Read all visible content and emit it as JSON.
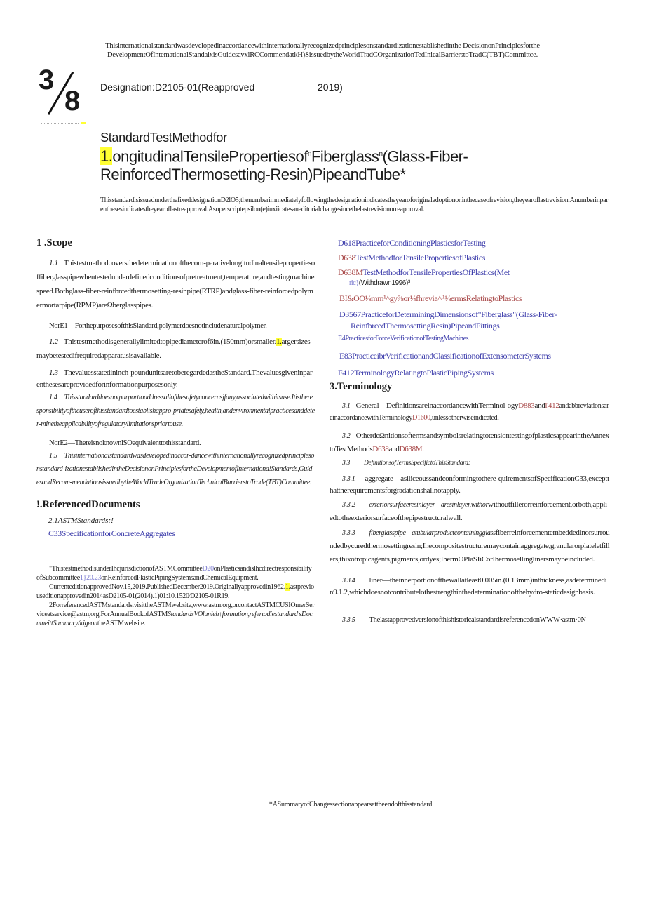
{
  "top_notice": {
    "line1": "Thisinternationalstandardwasdevelopedinaccordancewithinternationallyrecognizedprinciplesonstandardizationestablishedinthe DecisiononPrinciplesforthe",
    "line2": "DevelopmentOfIntemationalStandaixisGuidcsavxlRCCommendatkH)SissuedbytheWorldTradCOrganizationTedInicalBarrierstoTradC(TBT)Committce."
  },
  "logo": {
    "numerator": "3",
    "denominator": "8",
    "icon": "astm-logo-icon"
  },
  "designation": {
    "label": "Designation:D2105-01(Reapproved",
    "year": "2019)"
  },
  "title": {
    "line1": "StandardTestMethodfor",
    "line2_highlight": "1.",
    "line2_a": "ongitudinalTensilePropertiesof",
    "line2_sup1": "n",
    "line2_b": "Fiberglass",
    "line2_sup2": "n",
    "line2_c": "(Glass-Fiber-",
    "line3": "ReinforcedThermosetting-Resin)PipeandTube*"
  },
  "fixed_note": "ThisstandardisissuedunderthefixeddesignationD2lO5;thenumberimmediatelyfollowingthedesignationindicatestheyearoforiginaladoptionor.inthecaseofrevision,theyearoflastrevision.Anumberinparenthesesindicatestheyearoflastreapproval.Asuperscriptepsilon(e)iuxiicatesaneditorialchangesincethelastrevisionorreapproval.",
  "scope": {
    "heading": "1  .Scope",
    "p1_num": "1.1",
    "p1_text": "Thistestmethodcoversthedeterminationofthecom-parativelongitudinaltensilepropertiesoffiberglasspipewhentestedunderdefinedconditionsofpretreatment,temperature,andtestingmachinespeed.Bothglass-fiber-reinfbrcedthermosetting-resinpipe(RTRP)andglass-fiber-reinforcedpolymermortarpipe(RPMP)areΩberglasspipes.",
    "note1": "NorE1—ForthepurposesofthisSlandard,polymerdoesnotincludenaturalpolymer.",
    "p2_num": "1.2",
    "p2_text_a": "Thistestmethodisgenerallylimitedtopipediameterof6in.(150mm)orsmaller.",
    "p2_highlight": "1.",
    "p2_text_b": "argersizesmaybetestedifrequiredapparatusisavailable.",
    "p3_num": "1.3",
    "p3_text": "Thevaluesstatedininch-poundunitsaretoberegardedastheStandard.Thevaluesgiveninparenthesesareprovidedforinformationpurposesonly.",
    "p4_num": "1.4",
    "p4_text": "Thisstandarddoesnotpurporttoaddressallofthesafetyconcernsjfany,associatedwithitsuse.Itistheresponsibilityoftheuserofthisstandardtoestablishappro-priatesafety,health,andenvironmentalpracticesanddeter-minetheapplicabilityofregulatorylimitationspriortouse.",
    "note2": "NorE2—ThereisnoknownlSOequivalenttothisstandard.",
    "p5_num": "1.5",
    "p5_text": "Thisinternationalstandardwasdevelopedinaccor-dancewithinternationallyrecognizedprinciplesonstandard-izationestablishedintheDecisiononPrinciplesfortheDevelopmentofInternationa!Standards,GuidesandRecom-mendationsissuedbytheWorldTradeOrganizationTechnicalBarrierstoTrade(TBT)Committee."
  },
  "referenced": {
    "heading": "!.ReferencedDocuments",
    "sub": "2.1ASTMStandards:!",
    "c33": "C33SpecificationforConcreteAggregates"
  },
  "footnotes": {
    "f1_a": "\"ThistestmethodisunderIhcjurisdictionofASTMCommittee",
    "f1_link1": "D20",
    "f1_b": "onPlasticsandislhcdirectresponsibilityofSubcommittee",
    "f1_link2": "1}20.23",
    "f1_c": "onReinforcedPkisticPipingSystemsandChemicalEquipment.",
    "f2_a": "CurrenteditionapprovedNov.15,2019.PublishedDecember2019.Originallyapprovedin1962.",
    "f2_highlight": "1.",
    "f2_b": "astpreviouseditionapprovedin2014asD2105-01(2014).1)01:10.1520⁄D2105-01R19.",
    "f3_a": "2ForreferencedASTMstandards.visittheASTMwebsite,www.astm.org,orcontactASTMCUSIOmerServiceatservice@astm,org.ForAnnualBookofASTM",
    "f3_it": "StandardsVOlunleh↑formation,referιodiestandard'sDocutneittSummary/κigeon",
    "f3_b": "theASTMwebsite."
  },
  "right_refs": [
    {
      "code": "D618",
      "code_color": "blue",
      "text": "PracticeforConditioningPlasticsforTesting"
    },
    {
      "code": "D638",
      "code_color": "red",
      "text": "TestMethodforTensilePropertiesofPlastics"
    },
    {
      "code": "D638M",
      "code_color": "red",
      "text": "TestMethodforTensilePropertiesOfPlastics(Met",
      "cont_link": "ric}",
      "cont_plain": "(Withdrawn1996)³"
    },
    {
      "code": "BI&OO",
      "code_color": "red",
      "text": "⅛mm¹^gy⅞or¼fhrevia^ˡ¹⅛ermsRelatingtoPlastics"
    },
    {
      "code": "D3567",
      "code_color": "blue",
      "text": "PracticeforDeterminingDimensionsof\"Fiberglass\"(Glass-Fiber-",
      "cont_link": "ReinfbrcedThermosettingResin)PipeandFittings"
    },
    {
      "code": "E4",
      "code_color": "blue",
      "text": "PracticesforForceVerificationofTestingMachines"
    },
    {
      "code": "E83",
      "code_color": "blue",
      "text": "PracticeibrVerificationandClassificationofExtensometerSystems"
    },
    {
      "code": "F412",
      "code_color": "blue",
      "text": "TerminologyRelatingtoPlasticPipingSystems"
    }
  ],
  "terminology": {
    "heading": "3.Terminology",
    "p31_num": "3.1",
    "p31_a": "General—DefinitionsareinaccordancewithTerminol-ogy",
    "p31_l1": "D883",
    "p31_b": "and",
    "p31_l2": "l'412",
    "p31_c": "andabbreviationsareinaccordancewithTerminology",
    "p31_l3": "D1600",
    "p31_d": ",unlessotherwiseindicated.",
    "p32_num": "3.2",
    "p32_a": "OtherdeΩnitionsoftermsandsymbolsrelatingtotensiontestingofplasticsappearintheAnnextoTestMethods",
    "p32_l1": "D638",
    "p32_b": "and",
    "p32_l2": "D638M.",
    "p33_num": "3.3",
    "p33_text": "DefinitionsofTermsSpecifictoThisStandard:",
    "p331_num": "3.3.1",
    "p331_text": "aggregate—asiliceoussandconformingtothere-quirementsofSpecificationC33,exceptthattherequirementsforgradationshallnotapply.",
    "p332_num": "3.3.2",
    "p332_it": "exteriorsurfaceresinlayer—aresinlayer,withor",
    "p332_text": "withoutfillerorreinforcement,orboth,appliedtotheexteriorsurfaceofthepipestructuralwall.",
    "p333_num": "3.3.3",
    "p333_it": "fiberglasspipe—atubularproductcontainingglass",
    "p333_text": "fiberreinforcementembeddedinorsurroundedbycuredthermosettingresin;Ihecompositestructuremaycontainaggregate,granularorplateletfillers,thixotropicagents,pigments,ordyes;IhermOPIaSIiCorIhermosellinglinersmaybeincluded.",
    "p334_num": "3.3.4",
    "p334_text": "liner—theinnerportionofthewallatleast0.005in.(0.13mm)inthickness,asdeterminedin9.1.2,whichdoesnotcontributelothestrengthinthedeterminationofthehydro-staticdesignbasis.",
    "p335_num": "3.3.5",
    "p335_text": "ThelastapprovedversionofthishistoricalstandardisreferencedonWWW·astm·0N"
  },
  "summary_note": "*ASummaryofChangessectionappearsattheendofthisstandard",
  "colors": {
    "link_blue": "#3d3dab",
    "link_red": "#a84848",
    "highlight": "#ffff33"
  }
}
